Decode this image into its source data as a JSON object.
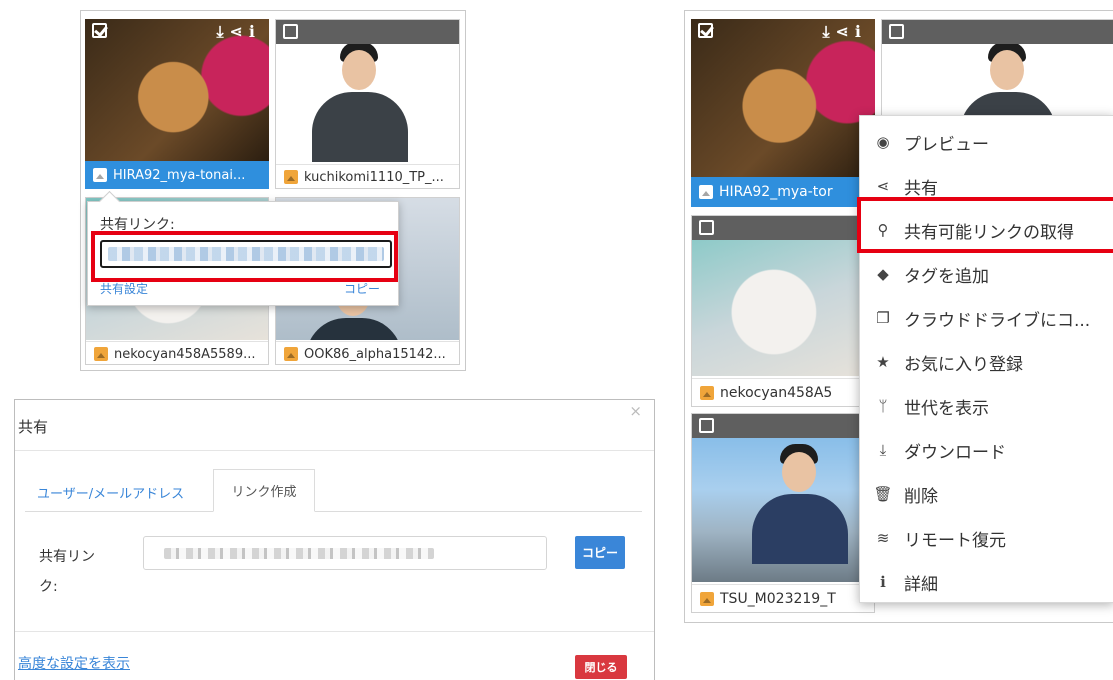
{
  "left_grid": {
    "tiles": [
      {
        "filename": "HIRA92_mya-tonai...",
        "selected": true
      },
      {
        "filename": "kuchikomi1110_TP_...",
        "selected": false
      },
      {
        "filename": "nekocyan458A5589...",
        "selected": false
      },
      {
        "filename": "OOK86_alpha15142...",
        "selected": false
      }
    ]
  },
  "share_popover": {
    "label": "共有リンク:",
    "settings_link": "共有設定",
    "copy_link": "コピー"
  },
  "right_grid": {
    "tiles": [
      {
        "filename": "HIRA92_mya-tor",
        "selected": true
      },
      {
        "filename": "nekocyan458A5",
        "selected": false
      },
      {
        "filename": "TSU_M023219_T",
        "selected": false
      }
    ]
  },
  "context_menu": {
    "items": [
      {
        "label": "プレビュー",
        "icon": "eye-icon",
        "glyph": "◉"
      },
      {
        "label": "共有",
        "icon": "share-icon",
        "glyph": "⋖"
      },
      {
        "label": "共有可能リンクの取得",
        "icon": "link-icon",
        "glyph": "⚲"
      },
      {
        "label": "タグを追加",
        "icon": "tag-icon",
        "glyph": "◆"
      },
      {
        "label": "クラウドドライブにコ...",
        "icon": "copy-icon",
        "glyph": "❐"
      },
      {
        "label": "お気に入り登録",
        "icon": "star-icon",
        "glyph": "★"
      },
      {
        "label": "世代を表示",
        "icon": "branch-icon",
        "glyph": "ᛘ"
      },
      {
        "label": "ダウンロード",
        "icon": "download-icon",
        "glyph": "⤓"
      },
      {
        "label": "削除",
        "icon": "trash-icon",
        "glyph": "🗑"
      },
      {
        "label": "リモート復元",
        "icon": "wifi-icon",
        "glyph": "≋"
      },
      {
        "label": "詳細",
        "icon": "info-icon",
        "glyph": "ℹ"
      }
    ]
  },
  "share_modal": {
    "title": "共有",
    "close_glyph": "×",
    "tabs": [
      "ユーザー/メールアドレス",
      "リンク作成"
    ],
    "field_label_line1": "共有リン",
    "field_label_line2": "ク:",
    "copy_button": "コピー",
    "advanced_link": "高度な設定を表示",
    "close_button": "閉じる"
  },
  "colors": {
    "highlight": "#e60012",
    "selected": "#2f8fdd",
    "primary_button": "#3a86d8",
    "danger_button": "#d9383f"
  }
}
